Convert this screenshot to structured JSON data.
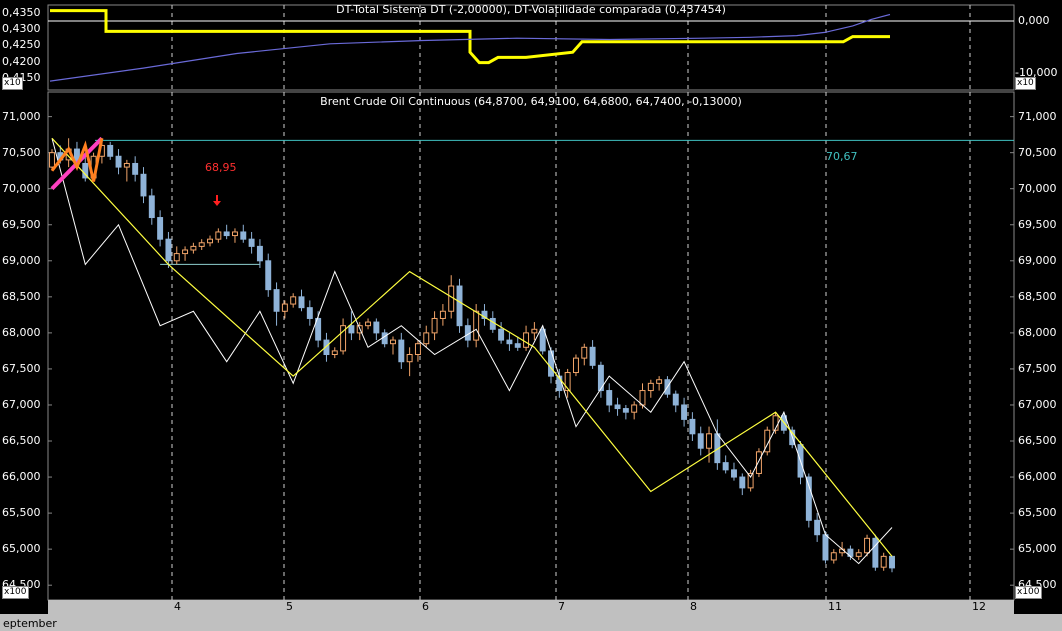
{
  "chart_data": [
    {
      "type": "line",
      "title": "DT-Total Sistema DT (-2,00000), DT-Volatilidade comparada (0,437454)",
      "left_ticks": [
        "0,4350",
        "0,4300",
        "0,4250",
        "0,4200",
        "0,4150"
      ],
      "right_ticks": [
        "0,000",
        "-10,000"
      ],
      "scale_label_left": "x10",
      "scale_label_right": "x10",
      "ylim_left": [
        0.4125,
        0.4365
      ],
      "ylim_right": [
        -12.5,
        2.5
      ],
      "series": [
        {
          "color": "#ffff00",
          "axis": "right",
          "x": [
            0.0,
            0.6,
            0.6,
            4.5,
            4.5,
            4.6,
            4.7,
            4.8,
            5.1,
            5.6,
            5.7,
            6.2,
            6.3,
            8.0,
            8.1,
            8.5,
            8.6,
            9.0
          ],
          "values": [
            2.0,
            2.0,
            -2.0,
            -2.0,
            -6.0,
            -8.0,
            -8.0,
            -7.0,
            -7.0,
            -6.0,
            -4.0,
            -4.0,
            -4.0,
            -4.0,
            -4.0,
            -4.0,
            -3.0,
            -3.0
          ]
        },
        {
          "color": "#6a6ad8",
          "axis": "left",
          "x": [
            0.0,
            1.0,
            2.0,
            3.0,
            4.0,
            5.0,
            6.0,
            7.0,
            7.5,
            8.0,
            8.3,
            8.6,
            8.8,
            9.0
          ],
          "values": [
            0.414,
            0.418,
            0.4225,
            0.4255,
            0.4265,
            0.4272,
            0.4268,
            0.4272,
            0.4275,
            0.428,
            0.429,
            0.431,
            0.433,
            0.4345
          ]
        }
      ]
    },
    {
      "type": "candlestick",
      "title": "Brent Crude Oil Continuous (64,8700, 64,9100, 64,6800, 64,7400, -0,13000)",
      "ylim": [
        64350,
        71300
      ],
      "yticks": [
        "71,000",
        "70,500",
        "70,000",
        "69,500",
        "69,000",
        "68,500",
        "68,000",
        "67,500",
        "67,000",
        "66,500",
        "66,000",
        "65,500",
        "65,000",
        "64,500"
      ],
      "scale_label": "x100",
      "month_label": "eptember",
      "xticks": [
        "4",
        "5",
        "6",
        "7",
        "8",
        "11",
        "12"
      ],
      "annotations": [
        {
          "text": "68,95",
          "color": "#ff3030"
        },
        {
          "text": "70,67",
          "color": "#40c0c0"
        }
      ],
      "hlines": [
        {
          "value": 70670,
          "color": "#40c0c0"
        }
      ],
      "candles": [
        [
          70300,
          70550,
          70250,
          70500
        ],
        [
          70500,
          70600,
          70350,
          70400
        ],
        [
          70400,
          70700,
          70300,
          70550
        ],
        [
          70550,
          70650,
          70300,
          70350
        ],
        [
          70350,
          70500,
          70100,
          70150
        ],
        [
          70150,
          70500,
          70100,
          70450
        ],
        [
          70450,
          70700,
          70350,
          70600
        ],
        [
          70600,
          70650,
          70400,
          70450
        ],
        [
          70450,
          70550,
          70200,
          70300
        ],
        [
          70300,
          70400,
          70100,
          70350
        ],
        [
          70350,
          70450,
          70100,
          70200
        ],
        [
          70200,
          70300,
          69800,
          69900
        ],
        [
          69900,
          70000,
          69500,
          69600
        ],
        [
          69600,
          69700,
          69200,
          69300
        ],
        [
          69300,
          69400,
          68900,
          69000
        ],
        [
          69000,
          69200,
          68950,
          69100
        ],
        [
          69100,
          69200,
          69000,
          69150
        ],
        [
          69150,
          69250,
          69100,
          69200
        ],
        [
          69200,
          69300,
          69150,
          69250
        ],
        [
          69250,
          69350,
          69200,
          69300
        ],
        [
          69300,
          69450,
          69250,
          69400
        ],
        [
          69400,
          69500,
          69300,
          69350
        ],
        [
          69350,
          69450,
          69250,
          69400
        ],
        [
          69400,
          69500,
          69250,
          69300
        ],
        [
          69300,
          69400,
          69100,
          69200
        ],
        [
          69200,
          69300,
          68900,
          69000
        ],
        [
          69000,
          69100,
          68500,
          68600
        ],
        [
          68600,
          68700,
          68100,
          68300
        ],
        [
          68300,
          68450,
          68200,
          68400
        ],
        [
          68400,
          68550,
          68350,
          68500
        ],
        [
          68500,
          68600,
          68300,
          68350
        ],
        [
          68350,
          68450,
          68100,
          68200
        ],
        [
          68200,
          68300,
          67800,
          67900
        ],
        [
          67900,
          68000,
          67600,
          67700
        ],
        [
          67700,
          67800,
          67650,
          67750
        ],
        [
          67750,
          68200,
          67700,
          68100
        ],
        [
          68100,
          68300,
          67900,
          68000
        ],
        [
          68000,
          68150,
          67900,
          68100
        ],
        [
          68100,
          68200,
          68050,
          68150
        ],
        [
          68150,
          68200,
          67900,
          68000
        ],
        [
          68000,
          68050,
          67800,
          67850
        ],
        [
          67850,
          67950,
          67700,
          67900
        ],
        [
          67900,
          68000,
          67500,
          67600
        ],
        [
          67600,
          67800,
          67400,
          67700
        ],
        [
          67700,
          67900,
          67600,
          67850
        ],
        [
          67850,
          68100,
          67800,
          68000
        ],
        [
          68000,
          68300,
          67900,
          68200
        ],
        [
          68200,
          68400,
          68100,
          68300
        ],
        [
          68300,
          68800,
          68200,
          68650
        ],
        [
          68650,
          68750,
          68000,
          68100
        ],
        [
          68100,
          68200,
          67800,
          67900
        ],
        [
          67900,
          68400,
          67800,
          68300
        ],
        [
          68300,
          68400,
          68100,
          68200
        ],
        [
          68200,
          68300,
          68000,
          68050
        ],
        [
          68050,
          68150,
          67850,
          67900
        ],
        [
          67900,
          68000,
          67750,
          67850
        ],
        [
          67850,
          67950,
          67750,
          67800
        ],
        [
          67800,
          68100,
          67750,
          68000
        ],
        [
          68000,
          68150,
          67900,
          68050
        ],
        [
          68050,
          68100,
          67700,
          67750
        ],
        [
          67750,
          67800,
          67300,
          67400
        ],
        [
          67400,
          67500,
          67100,
          67200
        ],
        [
          67200,
          67500,
          67100,
          67450
        ],
        [
          67450,
          67700,
          67400,
          67650
        ],
        [
          67650,
          67850,
          67550,
          67800
        ],
        [
          67800,
          67900,
          67500,
          67550
        ],
        [
          67550,
          67600,
          67100,
          67200
        ],
        [
          67200,
          67300,
          66900,
          67000
        ],
        [
          67000,
          67100,
          66850,
          66950
        ],
        [
          66950,
          67000,
          66800,
          66900
        ],
        [
          66900,
          67050,
          66800,
          67000
        ],
        [
          67000,
          67300,
          66950,
          67200
        ],
        [
          67200,
          67350,
          67100,
          67300
        ],
        [
          67300,
          67400,
          67200,
          67350
        ],
        [
          67350,
          67400,
          67100,
          67150
        ],
        [
          67150,
          67200,
          66900,
          67000
        ],
        [
          67000,
          67100,
          66700,
          66800
        ],
        [
          66800,
          66900,
          66500,
          66600
        ],
        [
          66600,
          66700,
          66300,
          66400
        ],
        [
          66400,
          66700,
          66200,
          66600
        ],
        [
          66600,
          66800,
          66100,
          66200
        ],
        [
          66200,
          66300,
          66050,
          66100
        ],
        [
          66100,
          66200,
          65950,
          66000
        ],
        [
          66000,
          66050,
          65750,
          65850
        ],
        [
          65850,
          66100,
          65800,
          66050
        ],
        [
          66050,
          66400,
          66000,
          66350
        ],
        [
          66350,
          66700,
          66300,
          66650
        ],
        [
          66650,
          66900,
          66600,
          66850
        ],
        [
          66850,
          66900,
          66600,
          66650
        ],
        [
          66650,
          66700,
          66400,
          66450
        ],
        [
          66450,
          66500,
          65900,
          66000
        ],
        [
          66000,
          66050,
          65300,
          65400
        ],
        [
          65400,
          65500,
          65100,
          65200
        ],
        [
          65200,
          65250,
          64800,
          64850
        ],
        [
          64850,
          65000,
          64800,
          64950
        ],
        [
          64950,
          65100,
          64900,
          65000
        ],
        [
          65000,
          65050,
          64850,
          64900
        ],
        [
          64900,
          65000,
          64850,
          64950
        ],
        [
          64950,
          65200,
          64900,
          65150
        ],
        [
          65150,
          65200,
          64700,
          64750
        ],
        [
          64750,
          64950,
          64700,
          64900
        ],
        [
          64900,
          64910,
          64680,
          64740
        ]
      ],
      "zigzag_white": [
        70700,
        68950,
        69500,
        68100,
        68300,
        67600,
        68300,
        67300,
        68850,
        67800,
        68100,
        67700,
        68050,
        67200,
        68100,
        66700,
        67400,
        66900,
        67600,
        66600,
        66000,
        66900,
        65200,
        64800,
        65300
      ],
      "zigzag_yellow": [
        70700,
        68950,
        67400,
        68850,
        67800,
        65800,
        66900,
        64900
      ]
    }
  ]
}
